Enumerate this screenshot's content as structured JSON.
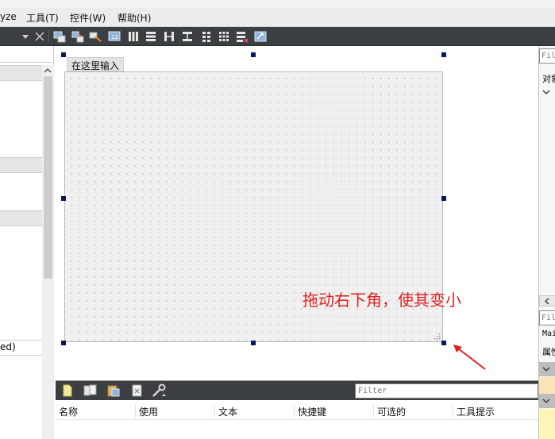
{
  "menubar": {
    "items": [
      "yze",
      "工具(T)",
      "控件(W)",
      "帮助(H)"
    ]
  },
  "toolbar": {
    "icons": [
      "dropdown-arrow-icon",
      "close-icon",
      "edit-widgets-icon",
      "edit-signals-icon",
      "edit-buddies-icon",
      "edit-tab-order-icon",
      "layout-horizontal-icon",
      "layout-vertical-icon",
      "layout-horizontal-splitter-icon",
      "layout-vertical-splitter-icon",
      "layout-form-icon",
      "layout-grid-icon",
      "break-layout-icon",
      "adjust-size-icon"
    ]
  },
  "left_dock": {
    "partial_label": "ed)"
  },
  "form": {
    "menu_entry_placeholder": "在这里输入"
  },
  "annotation": {
    "text": "拖动右下角，使其变小",
    "color": "#e02020"
  },
  "action_editor": {
    "filter_placeholder": "Filter",
    "columns": [
      "名称",
      "使用",
      "文本",
      "快捷键",
      "可选的",
      "工具提示"
    ]
  },
  "right_dock": {
    "filter_top": "Fil",
    "object_label": "对象",
    "filter_bottom": "Fil",
    "main_label": "Mai",
    "property_label": "属性"
  },
  "colors": {
    "toolbar_bg": "#3c3f41",
    "handle": "#0a1660",
    "form_bg": "#f0f0f0"
  }
}
